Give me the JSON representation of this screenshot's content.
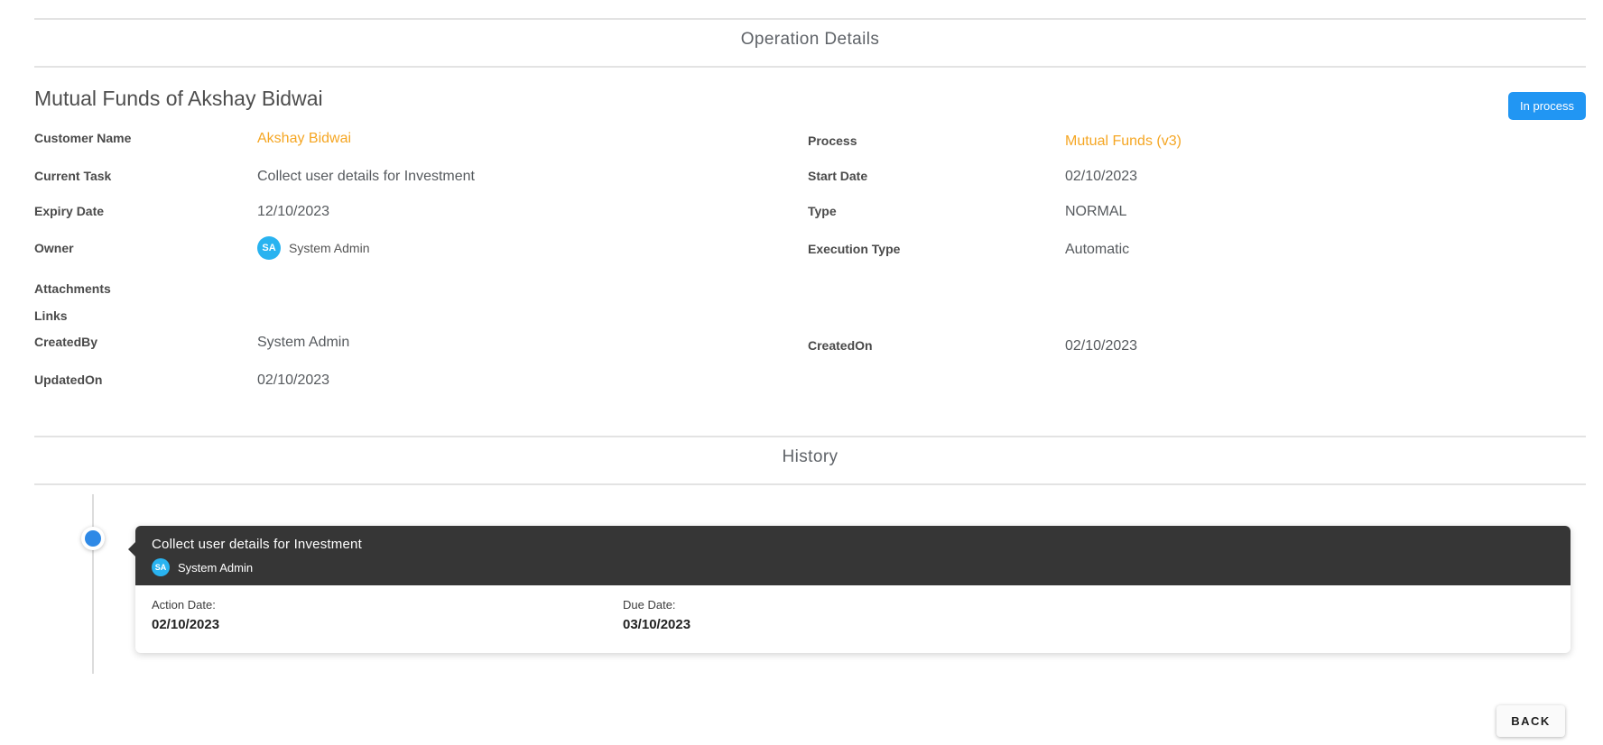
{
  "page": {
    "title": "Operation Details",
    "history_title": "History"
  },
  "operation": {
    "name": "Mutual Funds of Akshay Bidwai",
    "status": "In process",
    "fields_left": [
      {
        "label": "Customer Name",
        "value": "Akshay Bidwai"
      },
      {
        "label": "Current Task",
        "value": "Collect user details for Investment"
      },
      {
        "label": "Expiry Date",
        "value": "12/10/2023"
      },
      {
        "label": "Owner",
        "value": "System Admin",
        "avatar": "SA"
      },
      {
        "label": "Attachments",
        "value": ""
      },
      {
        "label": "Links",
        "value": ""
      },
      {
        "label": "CreatedBy",
        "value": "System Admin"
      },
      {
        "label": "UpdatedOn",
        "value": "02/10/2023"
      }
    ],
    "fields_right": [
      {
        "label": "Process",
        "value": "Mutual Funds (v3)"
      },
      {
        "label": "Start Date",
        "value": "02/10/2023"
      },
      {
        "label": "Type",
        "value": "NORMAL"
      },
      {
        "label": "Execution Type",
        "value": "Automatic"
      },
      {
        "label": "CreatedOn",
        "value": "02/10/2023"
      }
    ]
  },
  "history": {
    "entries": [
      {
        "task": "Collect user details for Investment",
        "user": "System Admin",
        "avatar": "SA",
        "action_date_label": "Action Date:",
        "action_date": "02/10/2023",
        "due_date_label": "Due Date:",
        "due_date": "03/10/2023"
      }
    ]
  },
  "actions": {
    "back": "BACK"
  },
  "colors": {
    "accent_orange": "#f5a623",
    "badge_blue": "#2196f3",
    "avatar_blue": "#29b3f0",
    "timeline_dot_blue": "#2e89e6",
    "card_header_dark": "#363636"
  }
}
